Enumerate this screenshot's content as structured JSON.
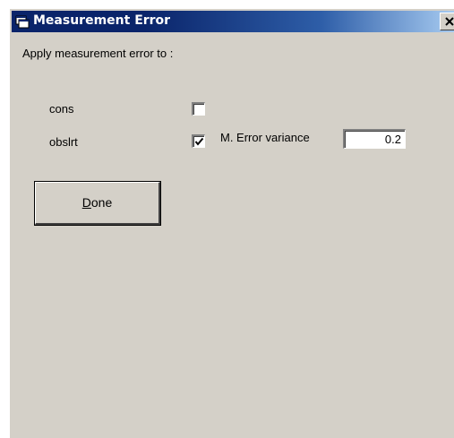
{
  "window": {
    "title": "Measurement Error",
    "icon": "app-window-icon",
    "close_icon": "close-icon"
  },
  "dialog": {
    "instruction": "Apply measurement error to :",
    "rows": [
      {
        "label": "cons",
        "checked": false
      },
      {
        "label": "obslrt",
        "checked": true
      }
    ],
    "variance_label": "M. Error variance",
    "variance_value": "0.2",
    "done_button": {
      "mnemonic": "D",
      "rest": "one"
    }
  }
}
